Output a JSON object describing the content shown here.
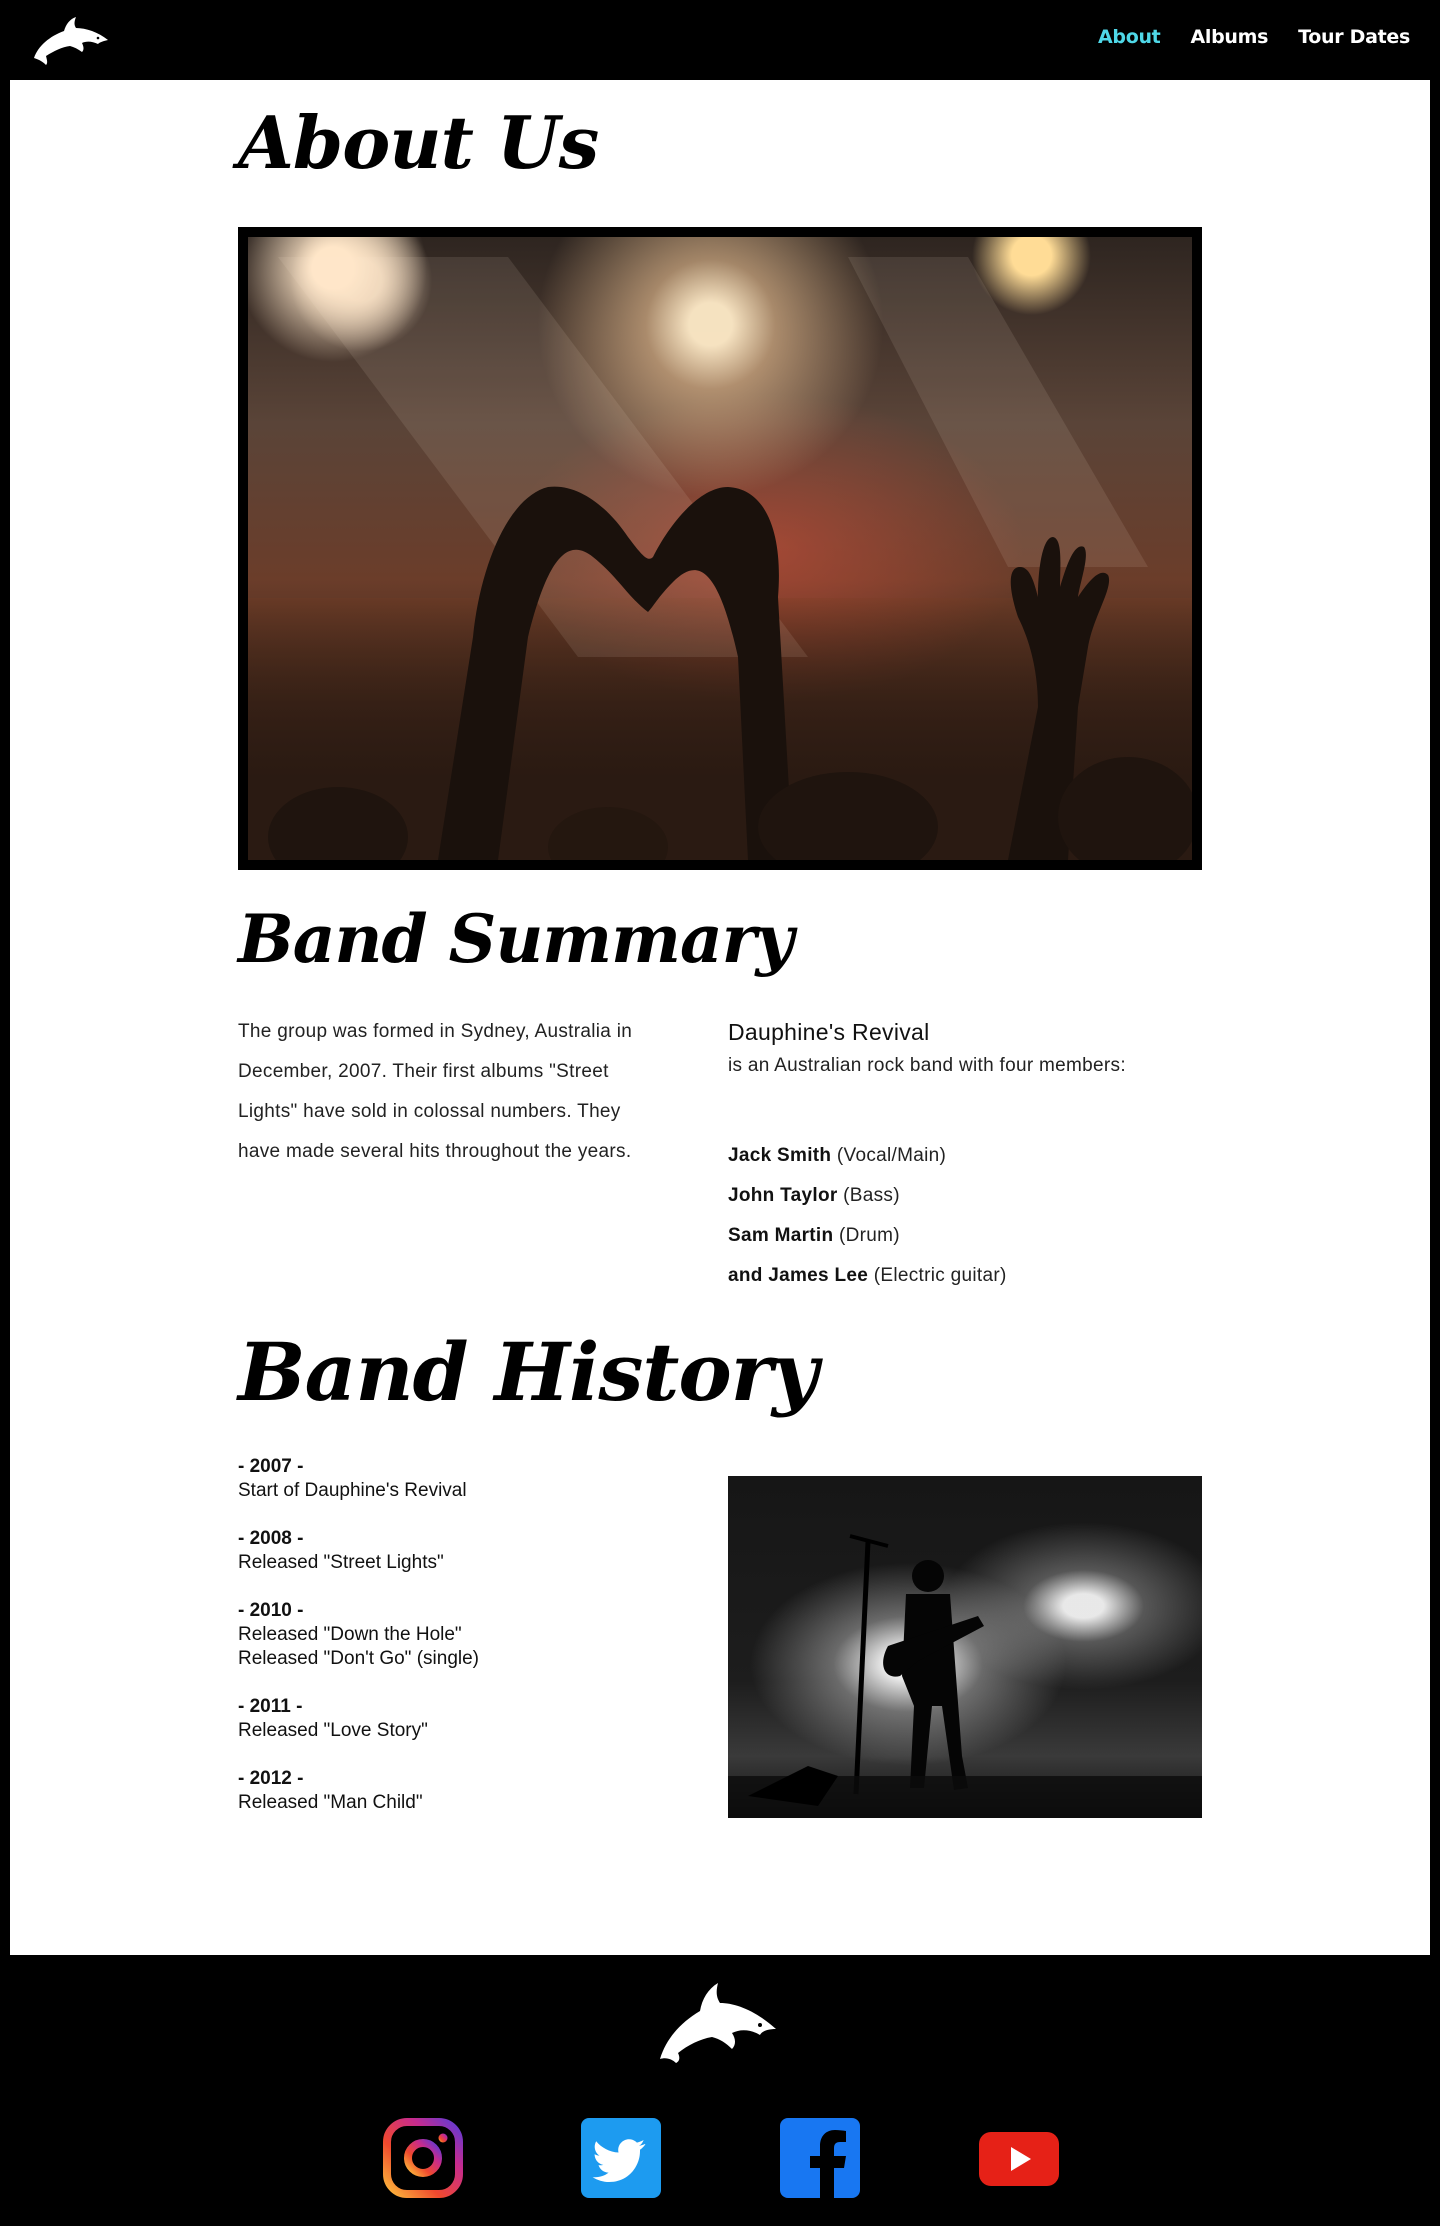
{
  "header": {
    "logo_icon": "dolphin-logo-icon",
    "nav": [
      {
        "label": "About",
        "active": true
      },
      {
        "label": "Albums",
        "active": false
      },
      {
        "label": "Tour Dates",
        "active": false
      }
    ]
  },
  "about": {
    "title": "About Us"
  },
  "summary": {
    "title": "Band Summary",
    "left_text": "The group was formed in Sydney, Australia in December, 2007. Their first albums \"Street Lights\" have sold in colossal numbers. They have made several hits throughout the years.",
    "band_name": "Dauphine's Revival",
    "band_desc": "is an Australian rock band with four members:",
    "members": [
      {
        "name": "Jack Smith",
        "role": " (Vocal/Main)"
      },
      {
        "name": "John Taylor",
        "role": " (Bass)"
      },
      {
        "name": "Sam Martin",
        "role": " (Drum)"
      },
      {
        "name": "and James Lee",
        "role": " (Electric guitar)"
      }
    ]
  },
  "history": {
    "title": "Band History",
    "timeline": [
      {
        "year": "- 2007 -",
        "lines": [
          "Start of Dauphine's Revival"
        ]
      },
      {
        "year": "- 2008 -",
        "lines": [
          "Released \"Street Lights\""
        ]
      },
      {
        "year": "- 2010 -",
        "lines": [
          "Released \"Down the Hole\"",
          "Released \"Don't Go\" (single)"
        ]
      },
      {
        "year": "- 2011 -",
        "lines": [
          "Released \"Love Story\""
        ]
      },
      {
        "year": "- 2012 -",
        "lines": [
          "Released \"Man Child\""
        ]
      }
    ]
  },
  "footer": {
    "socials": [
      "instagram-icon",
      "twitter-icon",
      "facebook-icon",
      "youtube-icon"
    ]
  },
  "colors": {
    "accent_nav_active": "#4fd8e8",
    "background": "#000000",
    "panel": "#ffffff"
  }
}
